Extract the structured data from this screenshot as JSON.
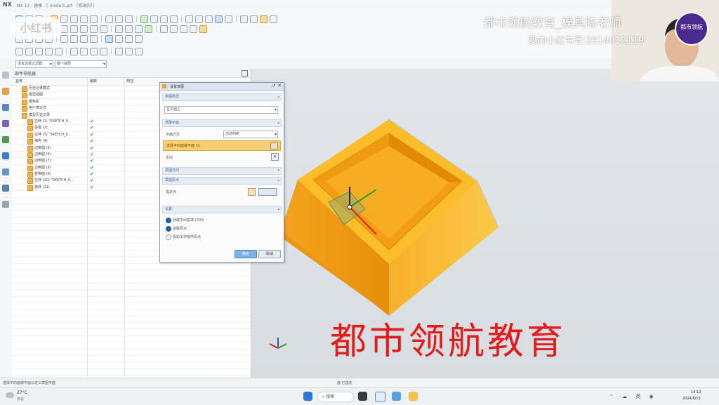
{
  "window": {
    "app": "NX",
    "title": "NX 12 - 建模 - [ model1.prt （修改的）]"
  },
  "watermark": {
    "xiaohongshu": "小红书",
    "title": "都市领航教育_模具陈老师",
    "account": "我的小红书号:2914012119",
    "logo_text": "都市领航",
    "big": "都市领航教育"
  },
  "selection_bar": {
    "filter": "没有选择过滤器",
    "scope": "整个装配"
  },
  "navigator": {
    "title": "部件导航器",
    "columns": [
      "名称",
      "最新",
      "附注"
    ],
    "items": [
      {
        "label": "历史记录模式",
        "check": ""
      },
      {
        "label": "模型视图",
        "check": ""
      },
      {
        "label": "摄像机",
        "check": ""
      },
      {
        "label": "用户表达式",
        "check": ""
      },
      {
        "label": "模型历史记录",
        "check": ""
      },
      {
        "label": "拉伸 (1) \"SKETCH_0...",
        "check": "✔"
      },
      {
        "label": "拔模 (2)",
        "check": "✔"
      },
      {
        "label": "拉伸 (3) \"SKETCH_0...",
        "check": "✔"
      },
      {
        "label": "抽壳 (4)",
        "check": "✔"
      },
      {
        "label": "边倒圆 (5)",
        "check": "✔"
      },
      {
        "label": "边倒圆 (6)",
        "check": "✔"
      },
      {
        "label": "边倒圆 (7)",
        "check": "✔"
      },
      {
        "label": "边倒圆 (8)",
        "check": "✔"
      },
      {
        "label": "替换面 (9)",
        "check": "✔"
      },
      {
        "label": "拉伸 (10) \"SKETCH_0...",
        "check": "✔"
      },
      {
        "label": "旋转 (11)",
        "check": "✔"
      }
    ]
  },
  "dialog": {
    "title": "设置草图",
    "sec_type": "草图类型",
    "type_value": "在平面上",
    "sec_plane": "草图平面",
    "plane_method_label": "平面方法",
    "plane_method_value": "自动判断",
    "select_face": "选择平的面或平面 (1)",
    "reverse_label": "反向",
    "sec_dir": "草图方向",
    "sec_origin": "草图原点",
    "origin_label": "指定点",
    "sec_settings": "设置",
    "opt1": "创建中间基准 CSYS",
    "opt2": "关联原点",
    "opt3": "投影工作部件原点",
    "ok": "确定",
    "cancel": "取消"
  },
  "status": {
    "left": "选择平的面或平面以定义草图平面",
    "center": "面 已选定"
  },
  "taskbar": {
    "weather_temp": "27°C",
    "weather_desc": "多云",
    "search": "搜索",
    "time": "14:12",
    "date": "2024/6/15"
  }
}
